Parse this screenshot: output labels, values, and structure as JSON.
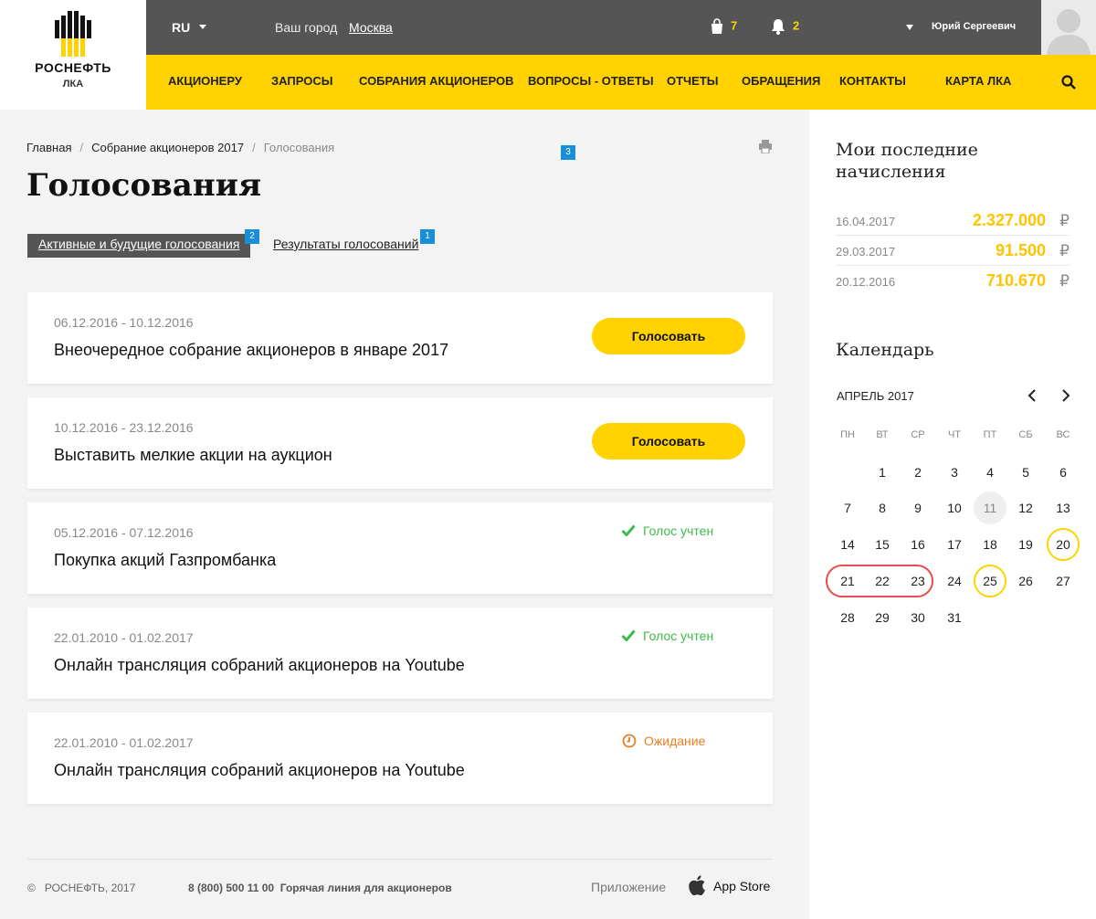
{
  "logo": {
    "brand": "РОСНЕФТЬ",
    "sub": "ЛКА"
  },
  "topbar": {
    "lang": "RU",
    "city_label": "Ваш город",
    "city_value": "Москва",
    "cart_count": "7",
    "notif_count": "2",
    "user_name": "Юрий Сергеевич"
  },
  "nav": {
    "items": [
      "АКЦИОНЕРУ",
      "ЗАПРОСЫ",
      "СОБРАНИЯ АКЦИОНЕРОВ",
      "ВОПРОСЫ - ОТВЕТЫ",
      "ОТЧЕТЫ",
      "ОБРАЩЕНИЯ",
      "КОНТАКТЫ",
      "КАРТА ЛКА"
    ]
  },
  "breadcrumb": {
    "items": [
      "Главная",
      "Собрание акционеров 2017",
      "Голосования"
    ],
    "separator": "/",
    "badge": "3"
  },
  "page_title": "Голосования",
  "tabs": [
    {
      "label": "Активные и будущие голосования",
      "badge": "2"
    },
    {
      "label": "Результаты голосований",
      "badge": "1"
    }
  ],
  "votes": [
    {
      "dates": "06.12.2016 - 10.12.2016",
      "title": "Внеочередное собрание акционеров в январе 2017",
      "action": "Голосовать"
    },
    {
      "dates": "10.12.2016 - 23.12.2016",
      "title": "Выставить мелкие акции на аукцион",
      "action": "Голосовать"
    },
    {
      "dates": "05.12.2016 - 07.12.2016",
      "title": "Покупка акций Газпромбанка",
      "status": "Голос учтен"
    },
    {
      "dates": "22.01.2010 - 01.02.2017",
      "title": "Онлайн трансляция собраний акционеров на Youtube",
      "status": "Голос учтен"
    },
    {
      "dates": "22.01.2010 - 01.02.2017",
      "title": "Онлайн трансляция собраний акционеров на Youtube",
      "status": "Ожидание"
    }
  ],
  "footer": {
    "copy": "©   РОСНЕФТЬ, 2017",
    "phone": "8 (800) 500 11 00  Горячая линия для акционеров",
    "app_label": "Приложение",
    "app_store": "App Store"
  },
  "sidebar": {
    "payments_title": "Мои последние начисления",
    "payments": [
      {
        "date": "16.04.2017",
        "amount": "2.327.000",
        "currency": "₽"
      },
      {
        "date": "29.03.2017",
        "amount": "91.500",
        "currency": "₽"
      },
      {
        "date": "20.12.2016",
        "amount": "710.670",
        "currency": "₽"
      }
    ],
    "calendar_title": "Календарь",
    "calendar_month": "АПРЕЛЬ 2017",
    "weekdays": [
      "ПН",
      "ВТ",
      "СР",
      "ЧТ",
      "ПТ",
      "СБ",
      "ВС"
    ],
    "days": [
      [
        "",
        "1",
        "2",
        "3",
        "4",
        "5",
        "6"
      ],
      [
        "7",
        "8",
        "9",
        "10",
        "11",
        "12",
        "13"
      ],
      [
        "14",
        "15",
        "16",
        "17",
        "18",
        "19",
        "20"
      ],
      [
        "21",
        "22",
        "23",
        "24",
        "25",
        "26",
        "27"
      ],
      [
        "28",
        "29",
        "30",
        "31",
        "",
        "",
        ""
      ]
    ],
    "today": "11",
    "marked_days": [
      "20",
      "25"
    ],
    "range_days": [
      "21",
      "22",
      "23"
    ]
  },
  "colors": {
    "accent": "#ffd200",
    "topbar": "#555555",
    "ok": "#3dbb4a",
    "wait": "#e67e22",
    "range": "#e74c4c"
  }
}
